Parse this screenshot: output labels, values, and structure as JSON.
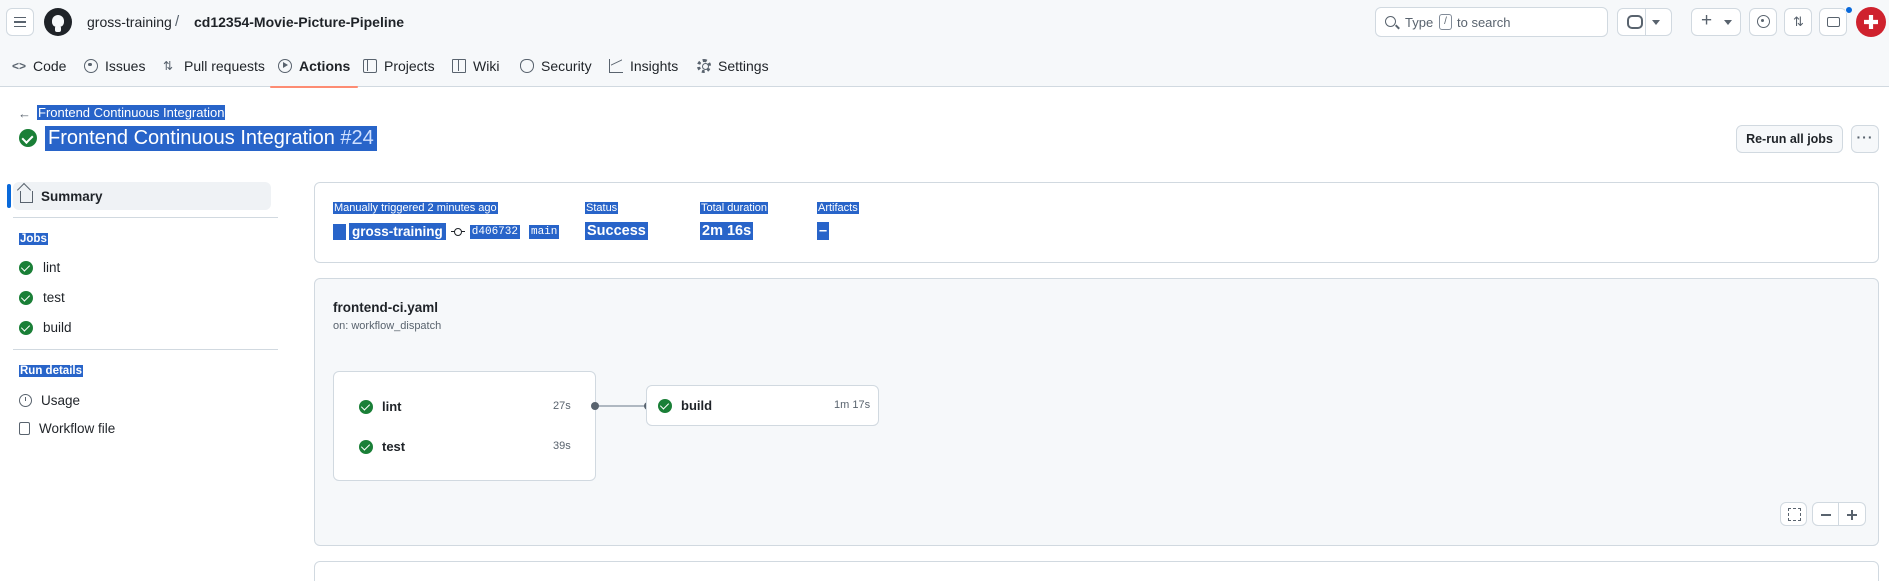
{
  "header": {
    "owner": "gross-training",
    "separator": "/",
    "repo": "cd12354-Movie-Picture-Pipeline",
    "search_type": "Type",
    "search_key": "/",
    "search_rest": "to search",
    "plus": "+"
  },
  "nav": {
    "tabs": [
      {
        "label": "Code",
        "icon": "code-icon"
      },
      {
        "label": "Issues",
        "icon": "issue-icon"
      },
      {
        "label": "Pull requests",
        "icon": "pull-request-icon"
      },
      {
        "label": "Actions",
        "icon": "play-icon",
        "active": true
      },
      {
        "label": "Projects",
        "icon": "table-icon"
      },
      {
        "label": "Wiki",
        "icon": "book-icon"
      },
      {
        "label": "Security",
        "icon": "shield-icon"
      },
      {
        "label": "Insights",
        "icon": "graph-icon"
      },
      {
        "label": "Settings",
        "icon": "gear-icon"
      }
    ]
  },
  "page": {
    "back_arrow": "←",
    "workflow_link": "Frontend Continuous Integration",
    "title": "Frontend Continuous Integration",
    "run_number": "#24",
    "rerun_label": "Re-run all jobs",
    "more_label": "···"
  },
  "sidebar": {
    "summary_label": "Summary",
    "jobs_heading": "Jobs",
    "jobs": [
      {
        "label": "lint",
        "status": "success"
      },
      {
        "label": "test",
        "status": "success"
      },
      {
        "label": "build",
        "status": "success"
      }
    ],
    "run_details_heading": "Run details",
    "usage_label": "Usage",
    "workflow_file_label": "Workflow file"
  },
  "summary": {
    "trigger_label": "Manually triggered 2 minutes ago",
    "user": "gross-training",
    "commit_sha": "d406732",
    "branch": "main",
    "status_label": "Status",
    "status_value": "Success",
    "duration_label": "Total duration",
    "duration_value": "2m 16s",
    "artifacts_label": "Artifacts",
    "artifacts_value": "–"
  },
  "workflow": {
    "file": "frontend-ci.yaml",
    "trigger": "on: workflow_dispatch",
    "group_jobs": [
      {
        "label": "lint",
        "duration": "27s"
      },
      {
        "label": "test",
        "duration": "39s"
      }
    ],
    "next_job": {
      "label": "build",
      "duration": "1m 17s"
    }
  },
  "colors": {
    "success": "#1a7f37",
    "selection": "#2864c9",
    "active_tab_underline": "#fd8c73",
    "accent": "#0969da"
  }
}
